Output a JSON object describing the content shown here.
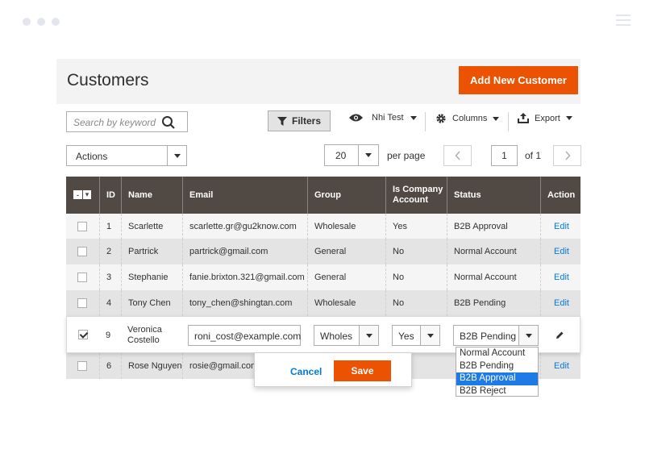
{
  "page": {
    "title": "Customers",
    "add_button": "Add New Customer"
  },
  "toolbar": {
    "search_placeholder": "Search by keyword",
    "filters_label": "Filters",
    "view_label": "Nhi Test",
    "columns_label": "Columns",
    "export_label": "Export",
    "actions_label": "Actions",
    "per_page_value": "20",
    "per_page_label": "per page",
    "page_number": "1",
    "page_of": "of 1"
  },
  "table": {
    "headers": [
      "ID",
      "Name",
      "Email",
      "Group",
      "Is Company Account",
      "Status",
      "Action"
    ],
    "rows": [
      {
        "id": "1",
        "name": "Scarlette",
        "email": "scarlette.gr@gu2know.com",
        "group": "Wholesale",
        "company": "Yes",
        "status": "B2B Approval",
        "action": "Edit"
      },
      {
        "id": "2",
        "name": "Partrick",
        "email": "partrick@gmail.com",
        "group": "General",
        "company": "No",
        "status": "Normal Account",
        "action": "Edit"
      },
      {
        "id": "3",
        "name": "Stephanie",
        "email": "fanie.brixton.321@gmail.com",
        "group": "General",
        "company": "No",
        "status": "Normal Account",
        "action": "Edit"
      },
      {
        "id": "4",
        "name": "Tony Chen",
        "email": "tony_chen@shingtan.com",
        "group": "Wholesale",
        "company": "No",
        "status": "B2B Pending",
        "action": "Edit"
      }
    ],
    "edit_row": {
      "id": "9",
      "name_line1": "Veronica",
      "name_line2": "Costello",
      "email": "roni_cost@example.com",
      "group": "Wholes",
      "company": "Yes",
      "status": "B2B Pending"
    },
    "last_row": {
      "id": "6",
      "name": "Rose Nguyen",
      "email": "rosie@gmail.com",
      "action": "Edit"
    }
  },
  "inline_edit": {
    "cancel": "Cancel",
    "save": "Save"
  },
  "status_options": [
    "Normal Account",
    "B2B Pending",
    "B2B Approval",
    "B2B Reject"
  ],
  "colors": {
    "accent": "#eb5202",
    "header_bg": "#514943",
    "link": "#007bdb",
    "selected_option": "#1e7be6"
  },
  "icons": [
    "search-icon",
    "filter-icon",
    "eye-icon",
    "gear-icon",
    "export-icon",
    "pencil-icon",
    "chevron-left-icon",
    "chevron-right-icon"
  ]
}
